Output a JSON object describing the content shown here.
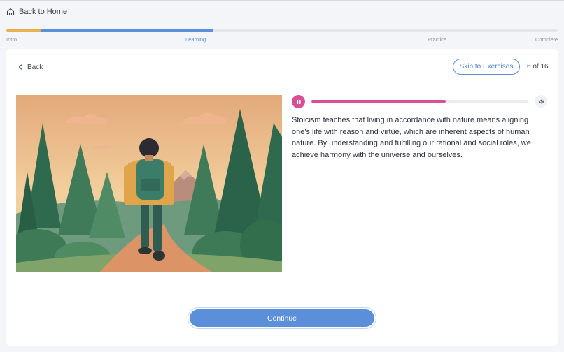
{
  "nav": {
    "back_to_home": "Back to Home"
  },
  "progress": {
    "steps": [
      "Intro",
      "Learning",
      "Practice",
      "Complete"
    ],
    "current_step": "Learning",
    "intro_fraction": 0.064,
    "learning_fraction": 0.376
  },
  "lesson": {
    "back_label": "Back",
    "skip_label": "Skip to Exercises",
    "page_count": "6 of 16",
    "text": "Stoicism teaches that living in accordance with nature means aligning one's life with reason and virtue, which are inherent aspects of human nature. By understanding and fulfilling our rational and social roles, we achieve harmony with the universe and ourselves."
  },
  "audio": {
    "progress": 0.62,
    "play_state": "pause-icon"
  },
  "illustration": {
    "subject": "hiker-in-forest-illustration"
  },
  "footer": {
    "continue_label": "Continue"
  },
  "colors": {
    "accent_blue": "#5b8fd9",
    "intro_orange": "#e8b04f",
    "audio_pink": "#d94f95"
  }
}
